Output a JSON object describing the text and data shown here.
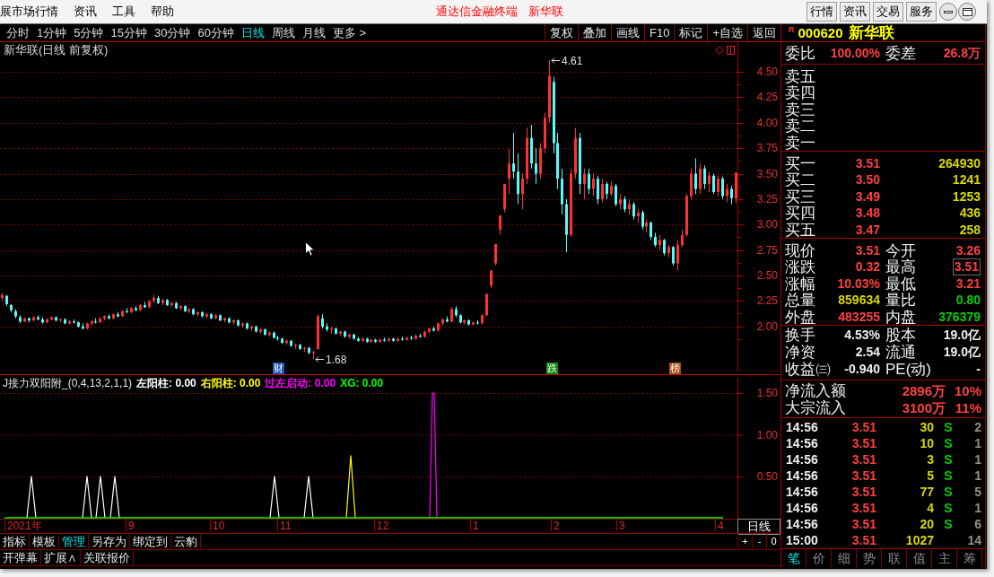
{
  "menu_bar": {
    "items": [
      "展市场行情",
      "资讯",
      "工具",
      "帮助"
    ],
    "app_title": "通达信金融终端",
    "stock_title": "新华联",
    "buttons": [
      "行情",
      "资讯",
      "交易",
      "服务"
    ]
  },
  "period_tabs": [
    {
      "label": "分时",
      "selected": false
    },
    {
      "label": "1分钟",
      "selected": false
    },
    {
      "label": "5分钟",
      "selected": false
    },
    {
      "label": "15分钟",
      "selected": false
    },
    {
      "label": "30分钟",
      "selected": false
    },
    {
      "label": "60分钟",
      "selected": false
    },
    {
      "label": "日线",
      "selected": true
    },
    {
      "label": "周线",
      "selected": false
    },
    {
      "label": "月线",
      "selected": false
    },
    {
      "label": "更多 >",
      "selected": false
    }
  ],
  "chart_tools": [
    "复权",
    "叠加",
    "画线",
    "F10",
    "标记",
    "+自选",
    "返回"
  ],
  "main_chart": {
    "title": "新华联(日线 前复权)",
    "chart_data": {
      "type": "candlestick",
      "grid": true,
      "categories": [
        null,
        null,
        null,
        null,
        null,
        null,
        null,
        null,
        null,
        null,
        null,
        null,
        null,
        null,
        null,
        null,
        null,
        null,
        null,
        null,
        null,
        null,
        null,
        null,
        null,
        null,
        null,
        null,
        null,
        null,
        null,
        null,
        null,
        null,
        null,
        null,
        null,
        null,
        null,
        null,
        null,
        null,
        null,
        null,
        null,
        null,
        null,
        null,
        null,
        null,
        null,
        null,
        null,
        null,
        null,
        null,
        null,
        null,
        null,
        null,
        null,
        null,
        null,
        null,
        null,
        null,
        null,
        null,
        null,
        null,
        null,
        null,
        null,
        null,
        null,
        null,
        null,
        null,
        null,
        null,
        null,
        null,
        null,
        null,
        null,
        null,
        null,
        null,
        null,
        null,
        null,
        null,
        null,
        null,
        null,
        null,
        null,
        null,
        null,
        null,
        null,
        null,
        null,
        null,
        null,
        null,
        null,
        null,
        null,
        null,
        null,
        null,
        null,
        null,
        null,
        null,
        null,
        null,
        null,
        null,
        null,
        null,
        null,
        null,
        null,
        null,
        null,
        null,
        null,
        null,
        null,
        null,
        null,
        null,
        null,
        null,
        null,
        null,
        null,
        null,
        null,
        null,
        null,
        null,
        null,
        null,
        null,
        null,
        null,
        null,
        null,
        null,
        null,
        null,
        null,
        null,
        null,
        null,
        null,
        null,
        null,
        null,
        null,
        null,
        null,
        null
      ],
      "ohlc": [
        [
          2.28,
          2.33,
          2.25,
          2.31
        ],
        [
          2.3,
          2.31,
          2.2,
          2.22
        ],
        [
          2.21,
          2.22,
          2.14,
          2.16
        ],
        [
          2.15,
          2.17,
          2.08,
          2.1
        ],
        [
          2.09,
          2.11,
          2.03,
          2.05
        ],
        [
          2.05,
          2.09,
          2.04,
          2.08
        ],
        [
          2.08,
          2.09,
          2.04,
          2.06
        ],
        [
          2.06,
          2.1,
          2.05,
          2.09
        ],
        [
          2.09,
          2.11,
          2.06,
          2.07
        ],
        [
          2.07,
          2.09,
          2.03,
          2.04
        ],
        [
          2.04,
          2.08,
          2.03,
          2.07
        ],
        [
          2.07,
          2.1,
          2.06,
          2.09
        ],
        [
          2.09,
          2.1,
          2.05,
          2.06
        ],
        [
          2.06,
          2.08,
          2.04,
          2.07
        ],
        [
          2.07,
          2.08,
          2.02,
          2.03
        ],
        [
          2.03,
          2.06,
          2.02,
          2.05
        ],
        [
          2.05,
          2.07,
          2.03,
          2.04
        ],
        [
          2.04,
          2.05,
          1.99,
          2.0
        ],
        [
          2.0,
          2.03,
          1.97,
          1.98
        ],
        [
          1.98,
          2.04,
          1.97,
          2.03
        ],
        [
          2.03,
          2.06,
          2.01,
          2.05
        ],
        [
          2.05,
          2.08,
          2.03,
          2.04
        ],
        [
          2.04,
          2.09,
          2.03,
          2.08
        ],
        [
          2.08,
          2.11,
          2.06,
          2.1
        ],
        [
          2.1,
          2.12,
          2.07,
          2.08
        ],
        [
          2.08,
          2.13,
          2.07,
          2.12
        ],
        [
          2.12,
          2.14,
          2.09,
          2.1
        ],
        [
          2.1,
          2.16,
          2.09,
          2.15
        ],
        [
          2.15,
          2.18,
          2.13,
          2.14
        ],
        [
          2.14,
          2.19,
          2.13,
          2.18
        ],
        [
          2.18,
          2.2,
          2.15,
          2.16
        ],
        [
          2.16,
          2.22,
          2.15,
          2.21
        ],
        [
          2.21,
          2.24,
          2.18,
          2.19
        ],
        [
          2.19,
          2.26,
          2.18,
          2.25
        ],
        [
          2.25,
          2.31,
          2.23,
          2.28
        ],
        [
          2.28,
          2.3,
          2.22,
          2.23
        ],
        [
          2.23,
          2.27,
          2.21,
          2.26
        ],
        [
          2.26,
          2.27,
          2.2,
          2.21
        ],
        [
          2.21,
          2.24,
          2.19,
          2.23
        ],
        [
          2.23,
          2.24,
          2.17,
          2.18
        ],
        [
          2.18,
          2.21,
          2.16,
          2.2
        ],
        [
          2.2,
          2.21,
          2.14,
          2.15
        ],
        [
          2.15,
          2.18,
          2.13,
          2.17
        ],
        [
          2.17,
          2.18,
          2.11,
          2.12
        ],
        [
          2.12,
          2.15,
          2.1,
          2.14
        ],
        [
          2.14,
          2.15,
          2.09,
          2.1
        ],
        [
          2.1,
          2.13,
          2.08,
          2.12
        ],
        [
          2.12,
          2.13,
          2.07,
          2.08
        ],
        [
          2.08,
          2.12,
          2.07,
          2.11
        ],
        [
          2.11,
          2.12,
          2.05,
          2.06
        ],
        [
          2.06,
          2.09,
          2.04,
          2.08
        ],
        [
          2.08,
          2.09,
          2.03,
          2.04
        ],
        [
          2.04,
          2.07,
          2.02,
          2.06
        ],
        [
          2.06,
          2.07,
          2.0,
          2.01
        ],
        [
          2.01,
          2.04,
          1.99,
          2.03
        ],
        [
          2.03,
          2.04,
          1.97,
          1.98
        ],
        [
          1.98,
          2.01,
          1.96,
          2.0
        ],
        [
          2.0,
          2.01,
          1.94,
          1.95
        ],
        [
          1.95,
          1.98,
          1.93,
          1.97
        ],
        [
          1.97,
          1.98,
          1.91,
          1.92
        ],
        [
          1.92,
          1.95,
          1.9,
          1.94
        ],
        [
          1.94,
          1.95,
          1.88,
          1.89
        ],
        [
          1.89,
          1.91,
          1.86,
          1.88
        ],
        [
          1.88,
          1.89,
          1.83,
          1.84
        ],
        [
          1.84,
          1.87,
          1.82,
          1.86
        ],
        [
          1.86,
          1.87,
          1.8,
          1.81
        ],
        [
          1.81,
          1.83,
          1.78,
          1.82
        ],
        [
          1.82,
          1.83,
          1.77,
          1.78
        ],
        [
          1.78,
          1.8,
          1.75,
          1.79
        ],
        [
          1.79,
          1.8,
          1.73,
          1.74
        ],
        [
          1.74,
          1.76,
          1.68,
          1.75
        ],
        [
          1.78,
          2.12,
          1.77,
          2.1
        ],
        [
          2.08,
          2.12,
          1.98,
          2.0
        ],
        [
          2.0,
          2.03,
          1.95,
          1.97
        ],
        [
          1.97,
          2.0,
          1.93,
          1.98
        ],
        [
          1.98,
          1.99,
          1.92,
          1.93
        ],
        [
          1.93,
          1.96,
          1.91,
          1.95
        ],
        [
          1.95,
          1.96,
          1.89,
          1.9
        ],
        [
          1.9,
          1.93,
          1.88,
          1.92
        ],
        [
          1.92,
          1.93,
          1.87,
          1.88
        ],
        [
          1.88,
          1.9,
          1.85,
          1.86
        ],
        [
          1.86,
          1.89,
          1.85,
          1.88
        ],
        [
          1.88,
          1.89,
          1.84,
          1.85
        ],
        [
          1.85,
          1.88,
          1.84,
          1.87
        ],
        [
          1.87,
          1.88,
          1.84,
          1.85
        ],
        [
          1.85,
          1.88,
          1.84,
          1.87
        ],
        [
          1.87,
          1.89,
          1.85,
          1.86
        ],
        [
          1.86,
          1.89,
          1.85,
          1.88
        ],
        [
          1.88,
          1.89,
          1.85,
          1.86
        ],
        [
          1.86,
          1.89,
          1.85,
          1.88
        ],
        [
          1.88,
          1.9,
          1.86,
          1.87
        ],
        [
          1.87,
          1.9,
          1.86,
          1.89
        ],
        [
          1.89,
          1.91,
          1.87,
          1.88
        ],
        [
          1.88,
          1.92,
          1.87,
          1.91
        ],
        [
          1.91,
          1.93,
          1.89,
          1.9
        ],
        [
          1.9,
          1.96,
          1.89,
          1.95
        ],
        [
          1.95,
          1.99,
          1.93,
          1.98
        ],
        [
          1.98,
          2.0,
          1.95,
          1.96
        ],
        [
          1.96,
          2.04,
          1.95,
          2.03
        ],
        [
          2.03,
          2.08,
          2.01,
          2.07
        ],
        [
          2.07,
          2.1,
          2.04,
          2.05
        ],
        [
          2.05,
          2.19,
          2.04,
          2.17
        ],
        [
          2.17,
          2.2,
          2.09,
          2.11
        ],
        [
          2.11,
          2.12,
          2.03,
          2.04
        ],
        [
          2.04,
          2.07,
          2.02,
          2.06
        ],
        [
          2.06,
          2.07,
          2.01,
          2.02
        ],
        [
          2.02,
          2.05,
          2.01,
          2.04
        ],
        [
          2.04,
          2.06,
          2.02,
          2.03
        ],
        [
          2.03,
          2.12,
          2.02,
          2.11
        ],
        [
          2.11,
          2.32,
          2.1,
          2.32
        ],
        [
          2.4,
          2.55,
          2.38,
          2.55
        ],
        [
          2.62,
          2.81,
          2.6,
          2.81
        ],
        [
          2.95,
          3.09,
          2.9,
          3.09
        ],
        [
          3.15,
          3.4,
          3.12,
          3.4
        ],
        [
          3.45,
          3.74,
          3.3,
          3.6
        ],
        [
          3.6,
          3.9,
          3.45,
          3.52
        ],
        [
          3.52,
          3.7,
          3.2,
          3.3
        ],
        [
          3.3,
          3.5,
          3.15,
          3.45
        ],
        [
          3.45,
          3.95,
          3.4,
          3.85
        ],
        [
          3.85,
          3.98,
          3.55,
          3.6
        ],
        [
          3.6,
          3.75,
          3.4,
          3.5
        ],
        [
          3.5,
          3.8,
          3.45,
          3.75
        ],
        [
          3.75,
          4.1,
          3.7,
          4.05
        ],
        [
          4.05,
          4.61,
          4.0,
          4.46
        ],
        [
          4.4,
          4.45,
          3.7,
          3.8
        ],
        [
          3.8,
          3.9,
          3.35,
          3.45
        ],
        [
          3.45,
          3.55,
          3.1,
          3.2
        ],
        [
          3.2,
          3.25,
          2.73,
          2.9
        ],
        [
          2.9,
          3.55,
          2.88,
          3.5
        ],
        [
          3.5,
          3.95,
          3.45,
          3.85
        ],
        [
          3.85,
          3.9,
          3.3,
          3.4
        ],
        [
          3.4,
          3.55,
          3.25,
          3.5
        ],
        [
          3.5,
          3.55,
          3.3,
          3.35
        ],
        [
          3.35,
          3.5,
          3.28,
          3.45
        ],
        [
          3.45,
          3.48,
          3.2,
          3.25
        ],
        [
          3.25,
          3.45,
          3.22,
          3.4
        ],
        [
          3.4,
          3.42,
          3.25,
          3.3
        ],
        [
          3.3,
          3.42,
          3.28,
          3.38
        ],
        [
          3.38,
          3.4,
          3.18,
          3.2
        ],
        [
          3.2,
          3.3,
          3.15,
          3.25
        ],
        [
          3.25,
          3.28,
          3.12,
          3.15
        ],
        [
          3.15,
          3.25,
          3.1,
          3.2
        ],
        [
          3.2,
          3.22,
          3.05,
          3.08
        ],
        [
          3.08,
          3.15,
          3.02,
          3.12
        ],
        [
          3.12,
          3.14,
          2.95,
          2.98
        ],
        [
          2.98,
          3.05,
          2.92,
          3.02
        ],
        [
          3.02,
          3.03,
          2.85,
          2.88
        ],
        [
          2.88,
          2.92,
          2.78,
          2.8
        ],
        [
          2.8,
          2.9,
          2.75,
          2.85
        ],
        [
          2.85,
          2.86,
          2.7,
          2.72
        ],
        [
          2.72,
          2.8,
          2.68,
          2.78
        ],
        [
          2.78,
          2.79,
          2.6,
          2.62
        ],
        [
          2.62,
          2.85,
          2.55,
          2.8
        ],
        [
          2.8,
          2.95,
          2.78,
          2.9
        ],
        [
          2.9,
          3.3,
          2.88,
          3.28
        ],
        [
          3.28,
          3.55,
          3.25,
          3.5
        ],
        [
          3.5,
          3.65,
          3.3,
          3.35
        ],
        [
          3.35,
          3.6,
          3.3,
          3.55
        ],
        [
          3.55,
          3.58,
          3.35,
          3.4
        ],
        [
          3.4,
          3.52,
          3.32,
          3.48
        ],
        [
          3.48,
          3.5,
          3.3,
          3.32
        ],
        [
          3.32,
          3.48,
          3.28,
          3.45
        ],
        [
          3.45,
          3.47,
          3.25,
          3.28
        ],
        [
          3.28,
          3.4,
          3.22,
          3.35
        ],
        [
          3.35,
          3.38,
          3.2,
          3.26
        ],
        [
          3.26,
          3.51,
          3.21,
          3.51
        ]
      ],
      "ylim": [
        0.1226,
        4.7905
      ],
      "yticks": [
        {
          "value": 4.5,
          "label": "4.50"
        },
        {
          "value": 4.25,
          "label": "4.25"
        },
        {
          "value": 4.0,
          "label": "4.00"
        },
        {
          "value": 3.75,
          "label": "3.75"
        },
        {
          "value": 3.5,
          "label": "3.50"
        },
        {
          "value": 3.25,
          "label": "3.25"
        },
        {
          "value": 3.0,
          "label": "3.00"
        },
        {
          "value": 2.75,
          "label": "2.75"
        },
        {
          "value": 2.5,
          "label": "2.50"
        },
        {
          "value": 2.25,
          "label": "2.25"
        },
        {
          "value": 2.0,
          "label": "2.00"
        }
      ],
      "annotations": [
        "4.61",
        "1.68"
      ]
    },
    "events": [
      {
        "label": "财",
        "color": "#2458b8"
      },
      {
        "label": "跌",
        "color": "#128a12"
      },
      {
        "label": "榜",
        "color": "#b0501a"
      }
    ]
  },
  "indicator": {
    "name": "J接力双阳附_(0,4,13,2,1,1)",
    "values": [
      {
        "label": "左阳柱: 0.00",
        "color": "#ffffff"
      },
      {
        "label": "右阳柱: 0.00",
        "color": "#ffff00"
      },
      {
        "label": "过左启动: 0.00",
        "color": "#ff00ff"
      },
      {
        "label": "XG: 0.00",
        "color": "#00ff00"
      }
    ],
    "axis": [
      "1.50",
      "1.00",
      "0.50"
    ]
  },
  "date_axis": [
    "2021年",
    "9",
    "10",
    "11",
    "12",
    "1",
    "2",
    "3",
    "4"
  ],
  "period_label": "日线",
  "bottom_tabs": [
    {
      "label": "指标",
      "selected": false
    },
    {
      "label": "模板",
      "selected": false
    },
    {
      "label": "管理",
      "selected": true
    },
    {
      "label": "另存为",
      "selected": false
    },
    {
      "label": "绑定到",
      "selected": false
    },
    {
      "label": "云豹",
      "selected": false
    }
  ],
  "zoom_buttons": [
    "+",
    "-",
    "0"
  ],
  "extra_tabs": [
    "开弹幕",
    "扩展∧",
    "关联报价"
  ],
  "quote": {
    "badge": "R",
    "code": "000620",
    "name": "新华联",
    "ratio": [
      {
        "label": "委比",
        "value": "100.00%",
        "color": "#ff4040"
      },
      {
        "label": "委差",
        "value": "26.8万",
        "color": "#ff4040"
      }
    ],
    "asks": [
      "卖五",
      "卖四",
      "卖三",
      "卖二",
      "卖一"
    ],
    "bids": [
      {
        "label": "买一",
        "price": "3.51",
        "volume": "264930"
      },
      {
        "label": "买二",
        "price": "3.50",
        "volume": "1241"
      },
      {
        "label": "买三",
        "price": "3.49",
        "volume": "1253"
      },
      {
        "label": "买四",
        "price": "3.48",
        "volume": "436"
      },
      {
        "label": "买五",
        "price": "3.47",
        "volume": "258"
      }
    ],
    "stats": [
      {
        "label": "现价",
        "value": "3.51",
        "color": "#ff4040",
        "highlighted": false
      },
      {
        "label": "今开",
        "value": "3.26",
        "color": "#ff4040",
        "highlighted": false
      },
      {
        "label": "涨跌",
        "value": "0.32",
        "color": "#ff4040",
        "highlighted": false
      },
      {
        "label": "最高",
        "value": "3.51",
        "color": "#ff4040",
        "highlighted": true
      },
      {
        "label": "涨幅",
        "value": "10.03%",
        "color": "#ff4040",
        "highlighted": false
      },
      {
        "label": "最低",
        "value": "3.21",
        "color": "#ff4040",
        "highlighted": false
      },
      {
        "label": "总量",
        "value": "859634",
        "color": "#d8d800",
        "highlighted": false
      },
      {
        "label": "量比",
        "value": "0.80",
        "color": "#00d000",
        "highlighted": false
      },
      {
        "label": "外盘",
        "value": "483255",
        "color": "#ff4040",
        "highlighted": false
      },
      {
        "label": "内盘",
        "value": "376379",
        "color": "#00d000",
        "highlighted": false
      }
    ],
    "fundamentals": [
      {
        "label": "换手",
        "value": "4.53%"
      },
      {
        "label": "股本",
        "value": "19.0亿"
      },
      {
        "label": "净资",
        "value": "2.54"
      },
      {
        "label": "流通",
        "value": "19.0亿"
      },
      {
        "label": "收益㈢",
        "value": "-0.940"
      },
      {
        "label": "PE(动)",
        "value": "-"
      }
    ],
    "flows": [
      {
        "label": "净流入额",
        "amount": "2896万",
        "percent": "10%"
      },
      {
        "label": "大宗流入",
        "amount": "3100万",
        "percent": "11%"
      }
    ],
    "trades": [
      {
        "time": "14:56",
        "price": "3.51",
        "volume": "30",
        "side": "S",
        "count": "2"
      },
      {
        "time": "14:56",
        "price": "3.51",
        "volume": "10",
        "side": "S",
        "count": "1"
      },
      {
        "time": "14:56",
        "price": "3.51",
        "volume": "3",
        "side": "S",
        "count": "1"
      },
      {
        "time": "14:56",
        "price": "3.51",
        "volume": "5",
        "side": "S",
        "count": "1"
      },
      {
        "time": "14:56",
        "price": "3.51",
        "volume": "77",
        "side": "S",
        "count": "5"
      },
      {
        "time": "14:56",
        "price": "3.51",
        "volume": "4",
        "side": "S",
        "count": "1"
      },
      {
        "time": "14:56",
        "price": "3.51",
        "volume": "20",
        "side": "S",
        "count": "6"
      },
      {
        "time": "15:00",
        "price": "3.51",
        "volume": "1027",
        "count": "14"
      }
    ],
    "tabs": [
      {
        "label": "笔",
        "selected": true
      },
      {
        "label": "价",
        "selected": false
      },
      {
        "label": "细",
        "selected": false
      },
      {
        "label": "势",
        "selected": false
      },
      {
        "label": "联",
        "selected": false
      },
      {
        "label": "值",
        "selected": false
      },
      {
        "label": "主",
        "selected": false
      },
      {
        "label": "筹",
        "selected": false
      }
    ]
  }
}
